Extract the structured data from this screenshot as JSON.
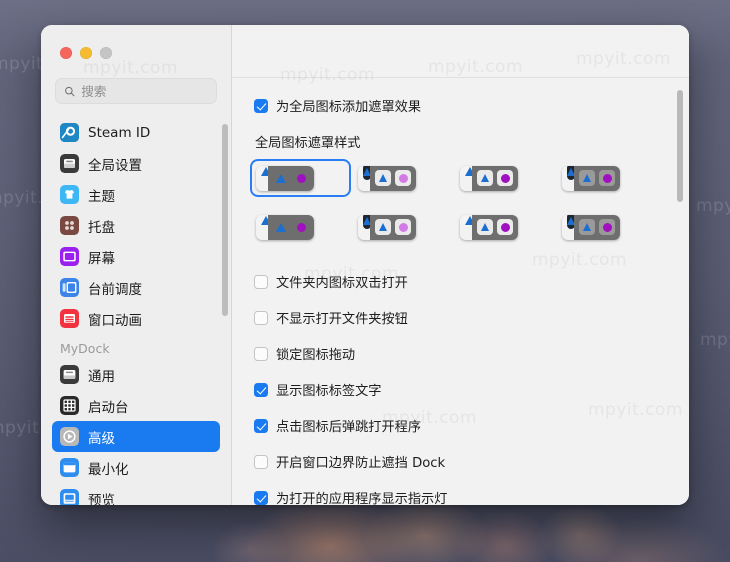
{
  "window": {
    "traffic_lights": [
      "close",
      "minimize",
      "zoom"
    ]
  },
  "watermark": {
    "text": "mpyit.com"
  },
  "search": {
    "placeholder": "搜索",
    "value": "",
    "icon": "search-icon"
  },
  "sidebar": {
    "items": [
      {
        "label": "Steam ID",
        "icon": "steam-icon",
        "selected": false,
        "group": null
      },
      {
        "label": "全局设置",
        "icon": "global-settings-icon",
        "selected": false,
        "group": null
      },
      {
        "label": "主题",
        "icon": "theme-icon",
        "selected": false,
        "group": null
      },
      {
        "label": "托盘",
        "icon": "tray-icon",
        "selected": false,
        "group": null
      },
      {
        "label": "屏幕",
        "icon": "screen-icon",
        "selected": false,
        "group": null
      },
      {
        "label": "台前调度",
        "icon": "stage-manager-icon",
        "selected": false,
        "group": null
      },
      {
        "label": "窗口动画",
        "icon": "window-animation-icon",
        "selected": false,
        "group": null
      }
    ],
    "group_label": "MyDock",
    "group_items": [
      {
        "label": "通用",
        "icon": "general-icon",
        "selected": false
      },
      {
        "label": "启动台",
        "icon": "launchpad-icon",
        "selected": false
      },
      {
        "label": "高级",
        "icon": "advanced-icon",
        "selected": true
      },
      {
        "label": "最小化",
        "icon": "minimize-icon",
        "selected": false
      },
      {
        "label": "预览",
        "icon": "preview-icon",
        "selected": false
      }
    ]
  },
  "panel": {
    "top_checkbox": {
      "label": "为全局图标添加遮罩效果",
      "checked": true
    },
    "style_section_title": "全局图标遮罩样式",
    "styles": [
      {
        "id": "style-1",
        "selected": true,
        "left_bg": "light",
        "right_bg": "dark",
        "left_badge": "none",
        "right_badge": "none",
        "triangle_left": "#1a6fd0",
        "circle_left": "#b431d0",
        "triangle_right": "#1a6fd0",
        "circle_right": "#a010c0"
      },
      {
        "id": "style-2",
        "selected": false,
        "left_bg": "light",
        "right_bg": "dark",
        "left_badge": "dark",
        "right_badge": "light",
        "triangle_left": "#1a6fd0",
        "circle_left": "#9c1ec0",
        "triangle_right": "#1a6fd0",
        "circle_right": "#d47ae6"
      },
      {
        "id": "style-3",
        "selected": false,
        "left_bg": "light",
        "right_bg": "dark",
        "left_badge": "none",
        "right_badge": "light",
        "triangle_left": "#1a6fd0",
        "circle_left": "#b431d0",
        "triangle_right": "#1a6fd0",
        "circle_right": "#a010c0"
      },
      {
        "id": "style-4",
        "selected": false,
        "left_bg": "light",
        "right_bg": "dark",
        "left_badge": "dark",
        "right_badge": "gray",
        "triangle_left": "#1a6fd0",
        "circle_left": "#9c1ec0",
        "triangle_right": "#1a6fd0",
        "circle_right": "#a010c0"
      },
      {
        "id": "style-5",
        "selected": false,
        "left_bg": "light",
        "right_bg": "dark",
        "left_badge": "none",
        "right_badge": "none",
        "triangle_left": "#1a6fd0",
        "circle_left": "#b431d0",
        "triangle_right": "#1a6fd0",
        "circle_right": "#a010c0"
      },
      {
        "id": "style-6",
        "selected": false,
        "left_bg": "light",
        "right_bg": "dark",
        "left_badge": "dark",
        "right_badge": "light",
        "triangle_left": "#1a6fd0",
        "circle_left": "#9c1ec0",
        "triangle_right": "#1a6fd0",
        "circle_right": "#d47ae6"
      },
      {
        "id": "style-7",
        "selected": false,
        "left_bg": "light",
        "right_bg": "dark",
        "left_badge": "none",
        "right_badge": "light",
        "triangle_left": "#1a6fd0",
        "circle_left": "#b431d0",
        "triangle_right": "#1a6fd0",
        "circle_right": "#a010c0"
      },
      {
        "id": "style-8",
        "selected": false,
        "left_bg": "light",
        "right_bg": "dark",
        "left_badge": "dark",
        "right_badge": "gray",
        "triangle_left": "#1a6fd0",
        "circle_left": "#9c1ec0",
        "triangle_right": "#1a6fd0",
        "circle_right": "#a010c0"
      }
    ],
    "options": [
      {
        "label": "文件夹内图标双击打开",
        "checked": false
      },
      {
        "label": "不显示打开文件夹按钮",
        "checked": false
      },
      {
        "label": "锁定图标拖动",
        "checked": false
      },
      {
        "label": "显示图标标签文字",
        "checked": true
      },
      {
        "label": "点击图标后弹跳打开程序",
        "checked": true
      },
      {
        "label": "开启窗口边界防止遮挡 Dock",
        "checked": false
      },
      {
        "label": "为打开的应用程序显示指示灯",
        "checked": true
      }
    ]
  },
  "colors": {
    "accent": "#1a7bf0",
    "selection": "#1a7bf0",
    "window_bg": "#f2f2f2",
    "sidebar_bg": "#eeeeee",
    "focus_ring": "#2b7df5"
  }
}
